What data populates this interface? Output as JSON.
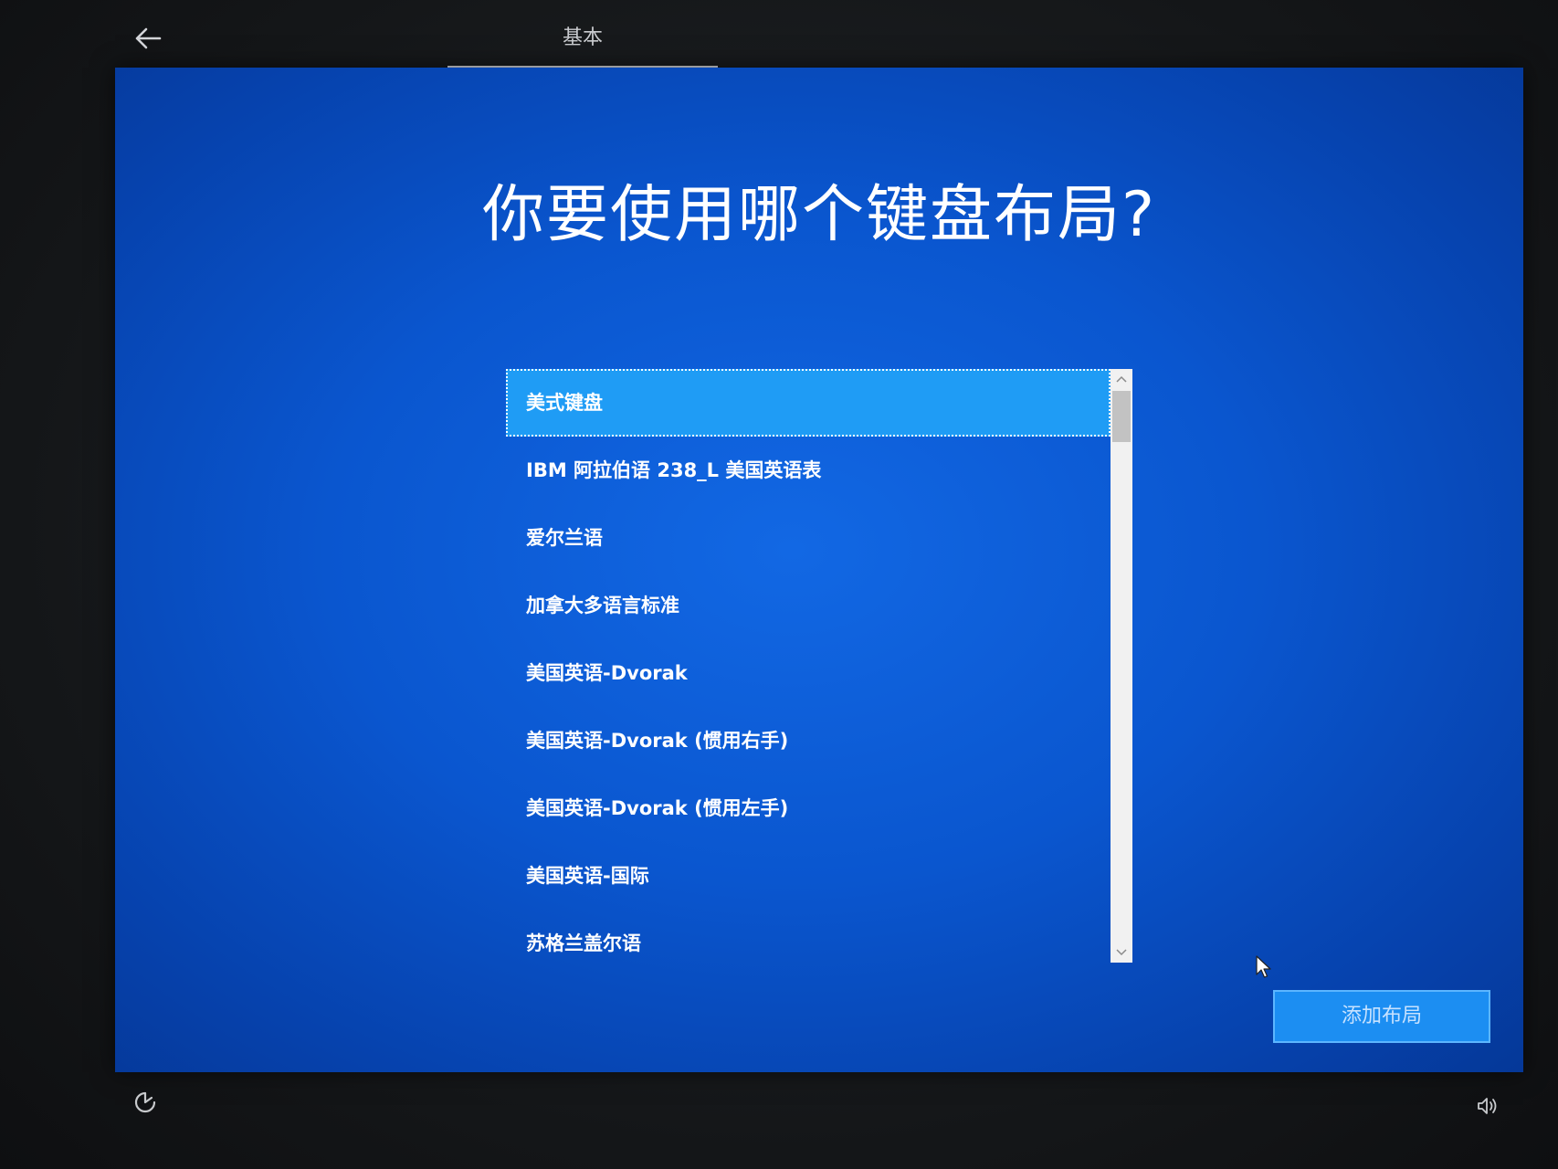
{
  "header": {
    "back_icon": "arrow-left-icon",
    "tab_label": "基本"
  },
  "main": {
    "title": "你要使用哪个键盘布局?",
    "layouts": [
      {
        "label": "美式键盘",
        "selected": true
      },
      {
        "label": "IBM 阿拉伯语 238_L 美国英语表",
        "selected": false
      },
      {
        "label": "爱尔兰语",
        "selected": false
      },
      {
        "label": "加拿大多语言标准",
        "selected": false
      },
      {
        "label": "美国英语-Dvorak",
        "selected": false
      },
      {
        "label": "美国英语-Dvorak (惯用右手)",
        "selected": false
      },
      {
        "label": "美国英语-Dvorak (惯用左手)",
        "selected": false
      },
      {
        "label": "美国英语-国际",
        "selected": false
      },
      {
        "label": "苏格兰盖尔语",
        "selected": false
      }
    ],
    "add_layout_label": "添加布局"
  },
  "footer": {
    "accessibility_icon": "ease-of-access-icon",
    "volume_icon": "speaker-icon"
  },
  "colors": {
    "panel_blue": "#0a56cf",
    "selected_item": "#1f9cf5",
    "button_blue": "#1c8ef2"
  }
}
